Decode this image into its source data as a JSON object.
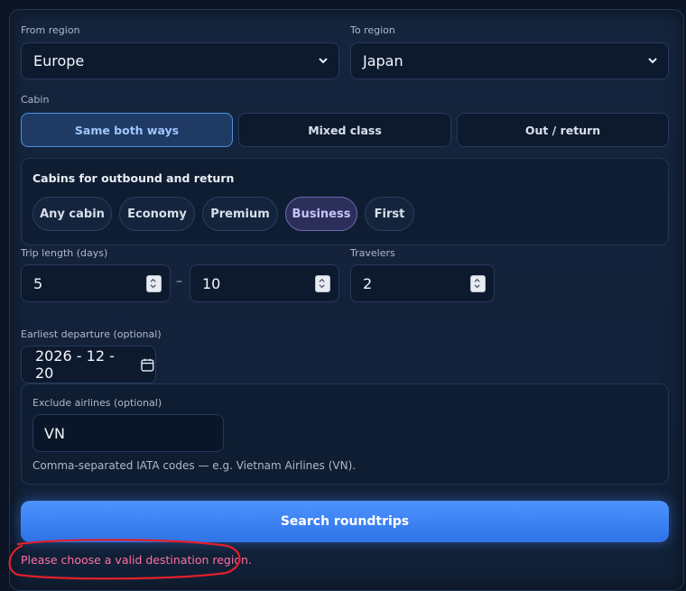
{
  "route": {
    "from_label": "From region",
    "from_value": "Europe",
    "to_label": "To region",
    "to_value": "Japan"
  },
  "cabin": {
    "label": "Cabin",
    "modes": [
      "Same both ways",
      "Mixed class",
      "Out / return"
    ],
    "active_mode": "Same both ways",
    "box_title": "Cabins for outbound and return",
    "chips": [
      "Any cabin",
      "Economy",
      "Premium",
      "Business",
      "First"
    ],
    "active_chip": "Business"
  },
  "trip": {
    "length_label": "Trip length (days)",
    "min": "5",
    "separator": "–",
    "max": "10",
    "travelers_label": "Travelers",
    "travelers": "2"
  },
  "departure": {
    "label": "Earliest departure (optional)",
    "value": "2026 - 12 - 20"
  },
  "exclude": {
    "label": "Exclude airlines (optional)",
    "value": "VN",
    "hint": "Comma-separated IATA codes — e.g. Vietnam Airlines (VN)."
  },
  "search_label": "Search roundtrips",
  "error_text": "Please choose a valid destination region.",
  "colors": {
    "accent": "#3d86f5",
    "error": "#ff6fa0",
    "annotation": "#e0202a"
  },
  "icons": {
    "select": "chevron-down-icon",
    "spinner": "spinner-arrows-icon",
    "date": "calendar-icon"
  }
}
